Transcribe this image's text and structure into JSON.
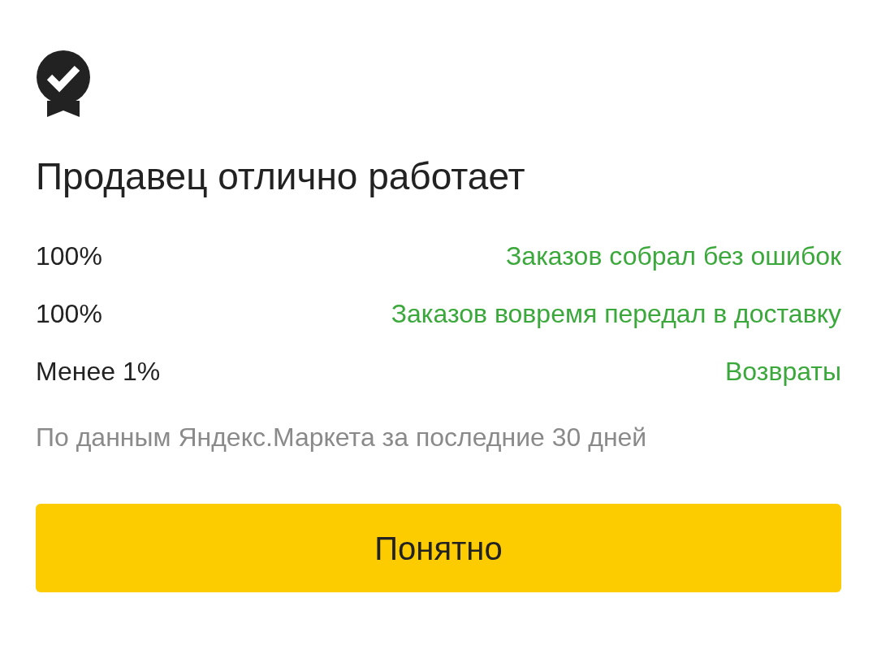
{
  "title": "Продавец отлично работает",
  "metrics": [
    {
      "value": "100%",
      "label": "Заказов собрал без ошибок"
    },
    {
      "value": "100%",
      "label": "Заказов вовремя передал в доставку"
    },
    {
      "value": "Менее 1%",
      "label": "Возвраты"
    }
  ],
  "note": "По данным Яндекс.Маркета за последние 30 дней",
  "button": "Понятно"
}
